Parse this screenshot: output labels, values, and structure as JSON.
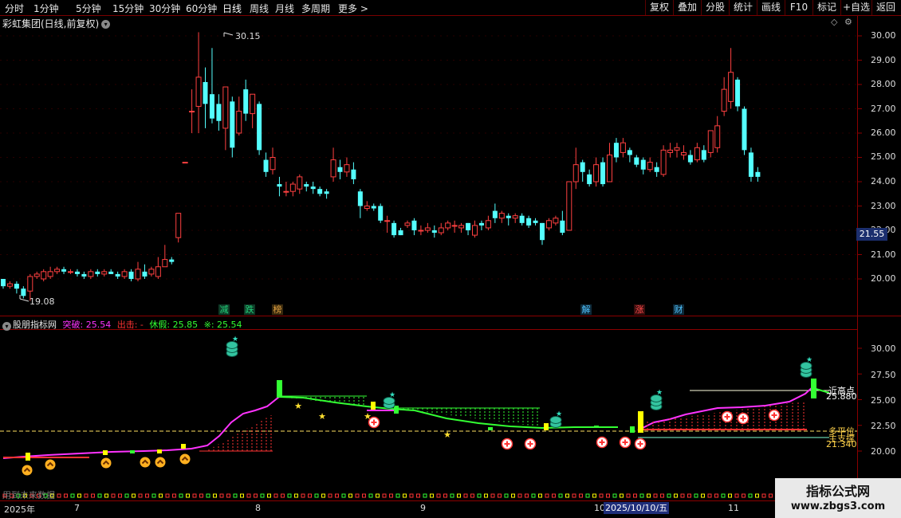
{
  "toolbar": {
    "periods": [
      "分时",
      "1分钟",
      "5分钟",
      "15分钟",
      "30分钟",
      "60分钟",
      "日线",
      "周线",
      "月线",
      "多周期",
      "更多 >"
    ],
    "active_period": "日线",
    "buttons": [
      "复权",
      "叠加",
      "分股",
      "统计",
      "画线",
      "F10",
      "标记",
      "+自选",
      "返回"
    ]
  },
  "main_chart": {
    "title": "彩虹集团(日线,前复权)",
    "high_label": "30.15",
    "low_label": "19.08",
    "current_price_tag": "21.55",
    "y_axis": [
      "30.00",
      "29.00",
      "28.00",
      "27.00",
      "26.00",
      "25.00",
      "24.00",
      "23.00",
      "22.00",
      "21.00",
      "20.00"
    ],
    "event_tags": [
      {
        "text": "减",
        "color": "#22d17a"
      },
      {
        "text": "跌",
        "color": "#22d17a"
      },
      {
        "text": "榜",
        "color": "#e0a040"
      },
      {
        "text": "解",
        "color": "#4fc3ff"
      },
      {
        "text": "涨",
        "color": "#ff4a4a"
      },
      {
        "text": "财",
        "color": "#4fc3ff"
      }
    ],
    "colors": {
      "up": "#ff4040",
      "down": "#54ffff",
      "ma_line": "#ffffff"
    }
  },
  "indicator": {
    "name": "股朋指标网",
    "label_breakout": "突破",
    "value_breakout": "25.54",
    "label_out": "出击",
    "value_out": "-",
    "label_rest": "休假",
    "value_rest": "25.85",
    "label_star": "※",
    "value_star": "25.54",
    "y_axis": [
      "30.00",
      "27.50",
      "25.00",
      "22.50",
      "20.00"
    ],
    "line_labels": {
      "near_high": "近高点",
      "near_high_value": "25.880",
      "label_b": "多平位",
      "label_c": "主支撑",
      "value_c": "21.340"
    },
    "colors": {
      "breakout": "#ff33ff",
      "rest": "#33ff33",
      "star": "#33ff33",
      "out": "#ff3333"
    }
  },
  "footer": {
    "text": "用到未来数据",
    "dates": [
      "2025年",
      "7",
      "8",
      "9",
      "10",
      "11"
    ],
    "current_date": "2025/10/10/五"
  },
  "watermark": {
    "title": "指标公式网",
    "url": "www.zbgs3.com"
  }
}
